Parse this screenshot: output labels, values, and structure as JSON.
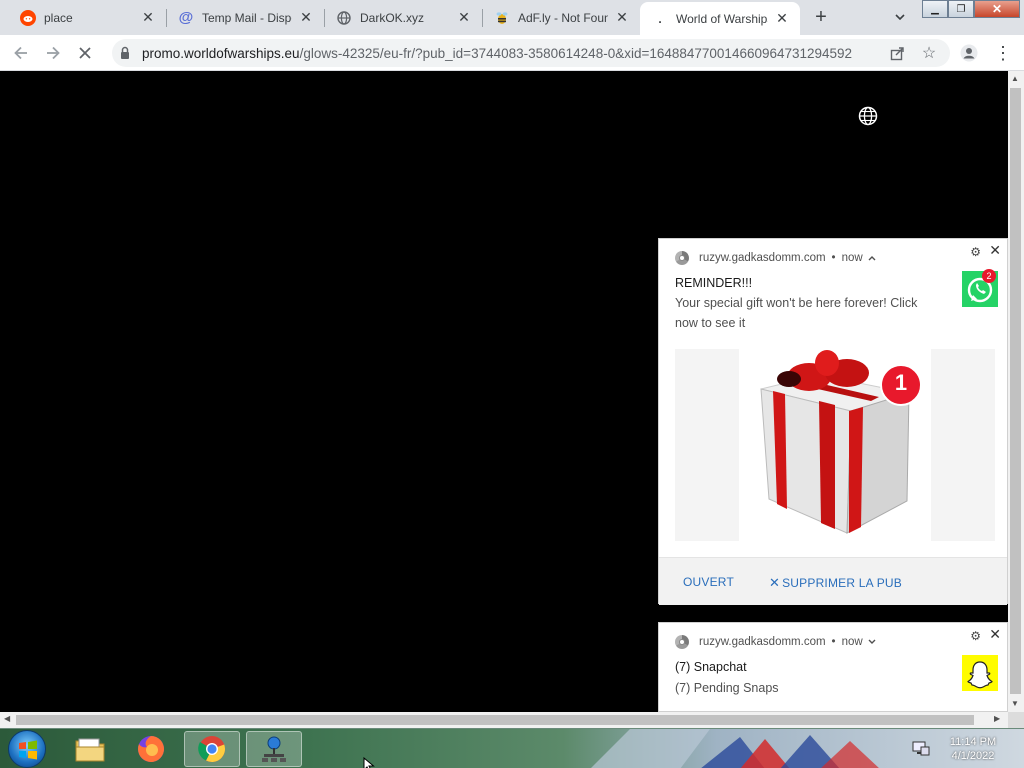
{
  "tabs": [
    {
      "title": "place",
      "icon": "reddit-icon"
    },
    {
      "title": "Temp Mail - Disposable",
      "icon": "at-sign-icon"
    },
    {
      "title": "DarkOK.xyz",
      "icon": "globe-icon"
    },
    {
      "title": "AdF.ly - Not Found",
      "icon": "bee-icon"
    },
    {
      "title": "World of Warships",
      "icon": "loading-icon"
    }
  ],
  "toolbar": {
    "url_host": "promo.worldofwarships.eu",
    "url_path": "/glows-42325/eu-fr/?pub_id=3744083-3580614248-0&xid=164884770014660964731294592"
  },
  "notifications": [
    {
      "source": "ruzyw.gadkasdomm.com",
      "time": "now",
      "title": "REMINDER!!!",
      "body": "Your special gift won't be here forever! Click now to see it",
      "badge": "2",
      "image_badge": "1",
      "actions": [
        "OUVERT",
        "SUPPRIMER LA PUB"
      ]
    },
    {
      "source": "ruzyw.gadkasdomm.com",
      "time": "now",
      "title": "(7) Snapchat",
      "body": "(7) Pending Snaps"
    }
  ],
  "taskbar": {
    "time": "11:14 PM",
    "date": "4/1/2022"
  },
  "colors": {
    "page_bg": "#000000",
    "whatsapp": "#25d366",
    "snapchat": "#fffc00",
    "gift_ribbon": "#d01616",
    "badge_red": "#e8192c",
    "action_blue": "#2a6ebb"
  }
}
